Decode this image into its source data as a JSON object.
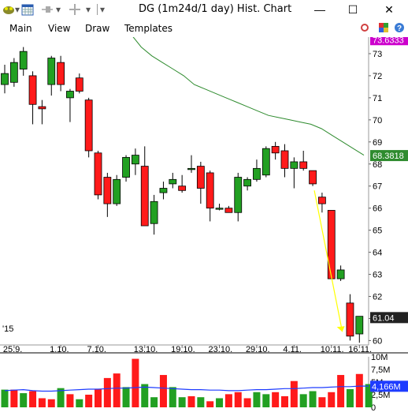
{
  "window": {
    "title": "DG (1m24d/1 day) Hist. Chart",
    "minimize": "—",
    "maximize": "☐",
    "close": "✕"
  },
  "toolbar": {
    "caret1": "▾",
    "caret2": "▾",
    "caret3": "▾"
  },
  "menu": {
    "items": [
      "Main",
      "View",
      "Draw",
      "Templates"
    ]
  },
  "colors": {
    "up": "#22a022",
    "down": "#ff1a1a",
    "ma": "#2e8b2e",
    "volume_avg": "#1e3cff",
    "arrow": "#ffff00",
    "ma_label_bg": "#2e8b2e",
    "price_top_bg": "#cc00cc",
    "last_label_bg": "#222222"
  },
  "chart_data": {
    "type": "candlestick",
    "symbol": "DG",
    "year_label": "'15",
    "x_ticks": [
      "25.9.",
      "1.10.",
      "7.10.",
      "13.10.",
      "19.10.",
      "23.10.",
      "29.10.",
      "4.11.",
      "10.11.",
      "16.11."
    ],
    "y_ticks": [
      60,
      61,
      62,
      63,
      64,
      65,
      66,
      67,
      68,
      69,
      70,
      71,
      72,
      73
    ],
    "ylim": [
      59.8,
      73.75
    ],
    "price_labels": {
      "top": "73.6333",
      "moving_average": "68.3818",
      "last": "61.04"
    },
    "candles": [
      {
        "o": 71.6,
        "h": 72.5,
        "l": 71.2,
        "c": 72.1
      },
      {
        "o": 71.7,
        "h": 72.8,
        "l": 71.5,
        "c": 72.6
      },
      {
        "o": 72.3,
        "h": 73.3,
        "l": 72.0,
        "c": 73.1
      },
      {
        "o": 72.0,
        "h": 72.2,
        "l": 69.8,
        "c": 70.7
      },
      {
        "o": 70.6,
        "h": 70.9,
        "l": 69.8,
        "c": 70.5
      },
      {
        "o": 71.6,
        "h": 72.9,
        "l": 71.1,
        "c": 72.8
      },
      {
        "o": 72.6,
        "h": 72.9,
        "l": 71.3,
        "c": 71.6
      },
      {
        "o": 71.0,
        "h": 71.4,
        "l": 69.9,
        "c": 71.3
      },
      {
        "o": 71.9,
        "h": 72.1,
        "l": 71.2,
        "c": 71.3
      },
      {
        "o": 70.9,
        "h": 71.0,
        "l": 68.3,
        "c": 68.6
      },
      {
        "o": 68.5,
        "h": 68.6,
        "l": 66.4,
        "c": 66.6
      },
      {
        "o": 67.4,
        "h": 67.6,
        "l": 65.6,
        "c": 66.2
      },
      {
        "o": 66.2,
        "h": 67.5,
        "l": 66.1,
        "c": 67.3
      },
      {
        "o": 67.4,
        "h": 68.4,
        "l": 67.2,
        "c": 68.3
      },
      {
        "o": 68.0,
        "h": 68.7,
        "l": 67.5,
        "c": 68.4
      },
      {
        "o": 67.9,
        "h": 68.8,
        "l": 65.3,
        "c": 65.2
      },
      {
        "o": 65.3,
        "h": 66.6,
        "l": 64.8,
        "c": 66.3
      },
      {
        "o": 66.7,
        "h": 67.2,
        "l": 66.4,
        "c": 66.9
      },
      {
        "o": 67.1,
        "h": 67.6,
        "l": 66.9,
        "c": 67.3
      },
      {
        "o": 67.0,
        "h": 67.5,
        "l": 66.7,
        "c": 66.8
      },
      {
        "o": 67.8,
        "h": 68.4,
        "l": 67.6,
        "c": 67.8
      },
      {
        "o": 67.9,
        "h": 68.1,
        "l": 66.2,
        "c": 66.9
      },
      {
        "o": 67.6,
        "h": 67.7,
        "l": 65.4,
        "c": 66.0
      },
      {
        "o": 66.0,
        "h": 66.2,
        "l": 65.9,
        "c": 66.0
      },
      {
        "o": 66.0,
        "h": 66.1,
        "l": 65.8,
        "c": 65.8
      },
      {
        "o": 65.8,
        "h": 67.6,
        "l": 65.4,
        "c": 67.4
      },
      {
        "o": 67.0,
        "h": 67.4,
        "l": 66.8,
        "c": 67.3
      },
      {
        "o": 67.3,
        "h": 68.2,
        "l": 67.2,
        "c": 67.8
      },
      {
        "o": 67.5,
        "h": 68.8,
        "l": 67.4,
        "c": 68.7
      },
      {
        "o": 68.8,
        "h": 69.0,
        "l": 68.2,
        "c": 68.5
      },
      {
        "o": 68.6,
        "h": 68.9,
        "l": 67.4,
        "c": 67.8
      },
      {
        "o": 67.8,
        "h": 68.3,
        "l": 66.9,
        "c": 68.1
      },
      {
        "o": 68.1,
        "h": 68.6,
        "l": 67.7,
        "c": 67.8
      },
      {
        "o": 67.7,
        "h": 67.7,
        "l": 67.0,
        "c": 67.1
      },
      {
        "o": 66.5,
        "h": 66.7,
        "l": 65.8,
        "c": 66.2
      },
      {
        "o": 65.9,
        "h": 65.9,
        "l": 62.8,
        "c": 62.8
      },
      {
        "o": 62.8,
        "h": 63.4,
        "l": 62.7,
        "c": 63.2
      },
      {
        "o": 61.7,
        "h": 62.1,
        "l": 60.0,
        "c": 60.2
      },
      {
        "o": 60.3,
        "h": 61.1,
        "l": 59.9,
        "c": 61.1
      }
    ],
    "moving_average": [
      75.6,
      75.2,
      74.7,
      74.3,
      73.9,
      73.3,
      72.9,
      72.6,
      72.3,
      72.0,
      71.6,
      71.4,
      71.2,
      71.0,
      70.8,
      70.6,
      70.4,
      70.2,
      70.1,
      70.0,
      69.9,
      69.8,
      69.6,
      69.3,
      69.0,
      68.7,
      68.4
    ],
    "arrow": {
      "from": [
        33,
        66.8
      ],
      "to": [
        36,
        60.4
      ]
    },
    "volume": {
      "y_ticks": [
        "10M",
        "7,5M",
        "5M",
        "2,5M",
        "0"
      ],
      "ylim": [
        0,
        10
      ],
      "avg_label": "4,166M",
      "bars": [
        {
          "v": 3.5,
          "up": true
        },
        {
          "v": 3.5,
          "up": false
        },
        {
          "v": 2.8,
          "up": true
        },
        {
          "v": 3.2,
          "up": false
        },
        {
          "v": 1.8,
          "up": false
        },
        {
          "v": 1.6,
          "up": false
        },
        {
          "v": 3.8,
          "up": true
        },
        {
          "v": 2.6,
          "up": false
        },
        {
          "v": 1.6,
          "up": true
        },
        {
          "v": 2.5,
          "up": false
        },
        {
          "v": 3.6,
          "up": false
        },
        {
          "v": 5.8,
          "up": false
        },
        {
          "v": 6.7,
          "up": false
        },
        {
          "v": 4.0,
          "up": true
        },
        {
          "v": 9.6,
          "up": false
        },
        {
          "v": 4.6,
          "up": true
        },
        {
          "v": 2.0,
          "up": true
        },
        {
          "v": 6.4,
          "up": false
        },
        {
          "v": 4.0,
          "up": true
        },
        {
          "v": 2.0,
          "up": true
        },
        {
          "v": 2.2,
          "up": false
        },
        {
          "v": 2.0,
          "up": true
        },
        {
          "v": 1.2,
          "up": false
        },
        {
          "v": 1.8,
          "up": true
        },
        {
          "v": 2.6,
          "up": false
        },
        {
          "v": 3.0,
          "up": false
        },
        {
          "v": 1.8,
          "up": false
        },
        {
          "v": 3.0,
          "up": true
        },
        {
          "v": 2.6,
          "up": true
        },
        {
          "v": 3.0,
          "up": false
        },
        {
          "v": 2.2,
          "up": false
        },
        {
          "v": 5.2,
          "up": false
        },
        {
          "v": 2.6,
          "up": true
        },
        {
          "v": 3.2,
          "up": true
        },
        {
          "v": 2.0,
          "up": false
        },
        {
          "v": 3.0,
          "up": false
        },
        {
          "v": 6.4,
          "up": false
        },
        {
          "v": 3.6,
          "up": true
        },
        {
          "v": 6.6,
          "up": false
        },
        {
          "v": 4.6,
          "up": true
        }
      ],
      "average": [
        3.3,
        3.4,
        3.5,
        3.3,
        3.2,
        3.2,
        3.3,
        3.4,
        3.5,
        3.6,
        3.6,
        3.7,
        3.8,
        3.8,
        3.9,
        4.0,
        3.9,
        3.8,
        3.7,
        3.6,
        3.5,
        3.5,
        3.4,
        3.4,
        3.3,
        3.3,
        3.4,
        3.5,
        3.5,
        3.6,
        3.7,
        3.7,
        3.8,
        3.9,
        3.9,
        4.0,
        4.1,
        4.1,
        4.2,
        4.2
      ]
    }
  }
}
